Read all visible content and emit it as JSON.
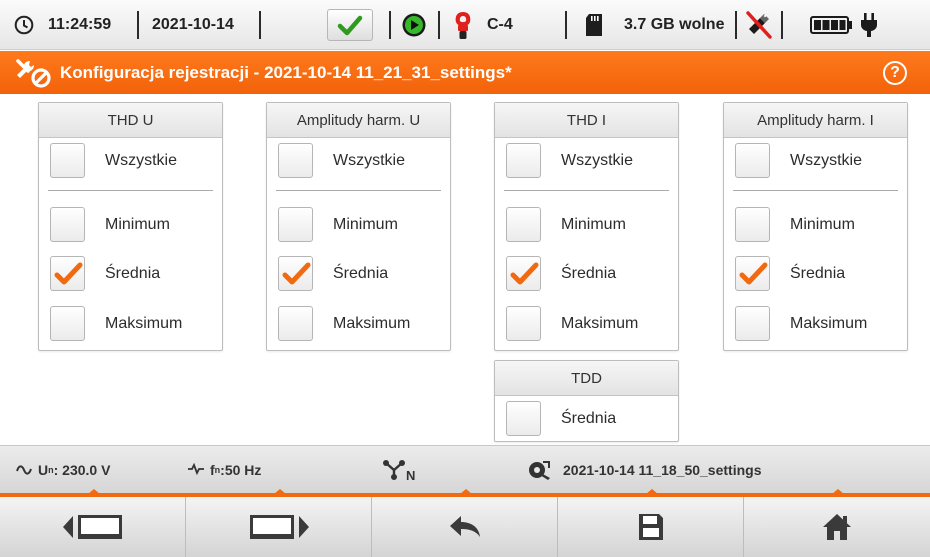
{
  "status_bar": {
    "time": "11:24:59",
    "date": "2021-10-14",
    "clamp_label": "C-4",
    "storage_free": "3.7 GB wolne"
  },
  "title_bar": {
    "title": "Konfiguracja rejestracji - 2021-10-14 11_21_31_settings*",
    "help_symbol": "?"
  },
  "panels": {
    "thd_u": {
      "title": "THD U",
      "all_label": "Wszystkie",
      "options": [
        {
          "label": "Minimum",
          "checked": false
        },
        {
          "label": "Średnia",
          "checked": true
        },
        {
          "label": "Maksimum",
          "checked": false
        }
      ]
    },
    "harm_u": {
      "title": "Amplitudy harm. U",
      "all_label": "Wszystkie",
      "options": [
        {
          "label": "Minimum",
          "checked": false
        },
        {
          "label": "Średnia",
          "checked": true
        },
        {
          "label": "Maksimum",
          "checked": false
        }
      ]
    },
    "thd_i": {
      "title": "THD I",
      "all_label": "Wszystkie",
      "options": [
        {
          "label": "Minimum",
          "checked": false
        },
        {
          "label": "Średnia",
          "checked": true
        },
        {
          "label": "Maksimum",
          "checked": false
        }
      ]
    },
    "harm_i": {
      "title": "Amplitudy harm. I",
      "all_label": "Wszystkie",
      "options": [
        {
          "label": "Minimum",
          "checked": false
        },
        {
          "label": "Średnia",
          "checked": true
        },
        {
          "label": "Maksimum",
          "checked": false
        }
      ]
    },
    "tdd": {
      "title": "TDD",
      "options": [
        {
          "label": "Średnia",
          "checked": false
        }
      ]
    }
  },
  "info_bar": {
    "voltage_prefix": "U",
    "voltage_sub": "n",
    "voltage_value": ": 230.0 V",
    "freq_prefix": "f",
    "freq_sub": "n",
    "freq_value": ":50 Hz",
    "network_sub": "N",
    "settings_file": "2021-10-14 11_18_50_settings"
  },
  "colors": {
    "accent": "#f26a10",
    "check_mark": "#f26a10"
  },
  "icons": {
    "toolbar": [
      "previous-screen-icon",
      "next-screen-icon",
      "back-arrow-icon",
      "save-icon",
      "home-icon"
    ]
  }
}
